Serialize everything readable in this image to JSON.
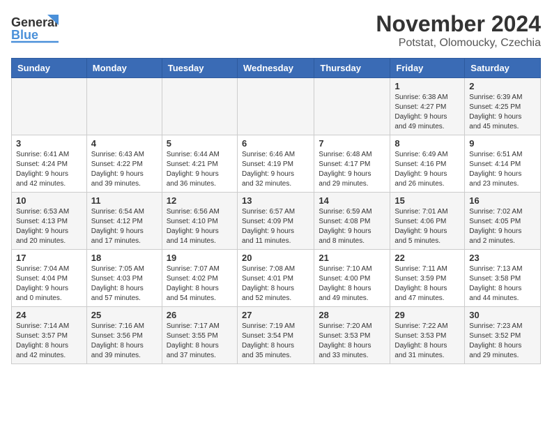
{
  "header": {
    "logo_line1": "General",
    "logo_line2": "Blue",
    "title": "November 2024",
    "subtitle": "Potstat, Olomoucky, Czechia"
  },
  "days_of_week": [
    "Sunday",
    "Monday",
    "Tuesday",
    "Wednesday",
    "Thursday",
    "Friday",
    "Saturday"
  ],
  "weeks": [
    [
      {
        "day": "",
        "info": ""
      },
      {
        "day": "",
        "info": ""
      },
      {
        "day": "",
        "info": ""
      },
      {
        "day": "",
        "info": ""
      },
      {
        "day": "",
        "info": ""
      },
      {
        "day": "1",
        "info": "Sunrise: 6:38 AM\nSunset: 4:27 PM\nDaylight: 9 hours\nand 49 minutes."
      },
      {
        "day": "2",
        "info": "Sunrise: 6:39 AM\nSunset: 4:25 PM\nDaylight: 9 hours\nand 45 minutes."
      }
    ],
    [
      {
        "day": "3",
        "info": "Sunrise: 6:41 AM\nSunset: 4:24 PM\nDaylight: 9 hours\nand 42 minutes."
      },
      {
        "day": "4",
        "info": "Sunrise: 6:43 AM\nSunset: 4:22 PM\nDaylight: 9 hours\nand 39 minutes."
      },
      {
        "day": "5",
        "info": "Sunrise: 6:44 AM\nSunset: 4:21 PM\nDaylight: 9 hours\nand 36 minutes."
      },
      {
        "day": "6",
        "info": "Sunrise: 6:46 AM\nSunset: 4:19 PM\nDaylight: 9 hours\nand 32 minutes."
      },
      {
        "day": "7",
        "info": "Sunrise: 6:48 AM\nSunset: 4:17 PM\nDaylight: 9 hours\nand 29 minutes."
      },
      {
        "day": "8",
        "info": "Sunrise: 6:49 AM\nSunset: 4:16 PM\nDaylight: 9 hours\nand 26 minutes."
      },
      {
        "day": "9",
        "info": "Sunrise: 6:51 AM\nSunset: 4:14 PM\nDaylight: 9 hours\nand 23 minutes."
      }
    ],
    [
      {
        "day": "10",
        "info": "Sunrise: 6:53 AM\nSunset: 4:13 PM\nDaylight: 9 hours\nand 20 minutes."
      },
      {
        "day": "11",
        "info": "Sunrise: 6:54 AM\nSunset: 4:12 PM\nDaylight: 9 hours\nand 17 minutes."
      },
      {
        "day": "12",
        "info": "Sunrise: 6:56 AM\nSunset: 4:10 PM\nDaylight: 9 hours\nand 14 minutes."
      },
      {
        "day": "13",
        "info": "Sunrise: 6:57 AM\nSunset: 4:09 PM\nDaylight: 9 hours\nand 11 minutes."
      },
      {
        "day": "14",
        "info": "Sunrise: 6:59 AM\nSunset: 4:08 PM\nDaylight: 9 hours\nand 8 minutes."
      },
      {
        "day": "15",
        "info": "Sunrise: 7:01 AM\nSunset: 4:06 PM\nDaylight: 9 hours\nand 5 minutes."
      },
      {
        "day": "16",
        "info": "Sunrise: 7:02 AM\nSunset: 4:05 PM\nDaylight: 9 hours\nand 2 minutes."
      }
    ],
    [
      {
        "day": "17",
        "info": "Sunrise: 7:04 AM\nSunset: 4:04 PM\nDaylight: 9 hours\nand 0 minutes."
      },
      {
        "day": "18",
        "info": "Sunrise: 7:05 AM\nSunset: 4:03 PM\nDaylight: 8 hours\nand 57 minutes."
      },
      {
        "day": "19",
        "info": "Sunrise: 7:07 AM\nSunset: 4:02 PM\nDaylight: 8 hours\nand 54 minutes."
      },
      {
        "day": "20",
        "info": "Sunrise: 7:08 AM\nSunset: 4:01 PM\nDaylight: 8 hours\nand 52 minutes."
      },
      {
        "day": "21",
        "info": "Sunrise: 7:10 AM\nSunset: 4:00 PM\nDaylight: 8 hours\nand 49 minutes."
      },
      {
        "day": "22",
        "info": "Sunrise: 7:11 AM\nSunset: 3:59 PM\nDaylight: 8 hours\nand 47 minutes."
      },
      {
        "day": "23",
        "info": "Sunrise: 7:13 AM\nSunset: 3:58 PM\nDaylight: 8 hours\nand 44 minutes."
      }
    ],
    [
      {
        "day": "24",
        "info": "Sunrise: 7:14 AM\nSunset: 3:57 PM\nDaylight: 8 hours\nand 42 minutes."
      },
      {
        "day": "25",
        "info": "Sunrise: 7:16 AM\nSunset: 3:56 PM\nDaylight: 8 hours\nand 39 minutes."
      },
      {
        "day": "26",
        "info": "Sunrise: 7:17 AM\nSunset: 3:55 PM\nDaylight: 8 hours\nand 37 minutes."
      },
      {
        "day": "27",
        "info": "Sunrise: 7:19 AM\nSunset: 3:54 PM\nDaylight: 8 hours\nand 35 minutes."
      },
      {
        "day": "28",
        "info": "Sunrise: 7:20 AM\nSunset: 3:53 PM\nDaylight: 8 hours\nand 33 minutes."
      },
      {
        "day": "29",
        "info": "Sunrise: 7:22 AM\nSunset: 3:53 PM\nDaylight: 8 hours\nand 31 minutes."
      },
      {
        "day": "30",
        "info": "Sunrise: 7:23 AM\nSunset: 3:52 PM\nDaylight: 8 hours\nand 29 minutes."
      }
    ]
  ]
}
